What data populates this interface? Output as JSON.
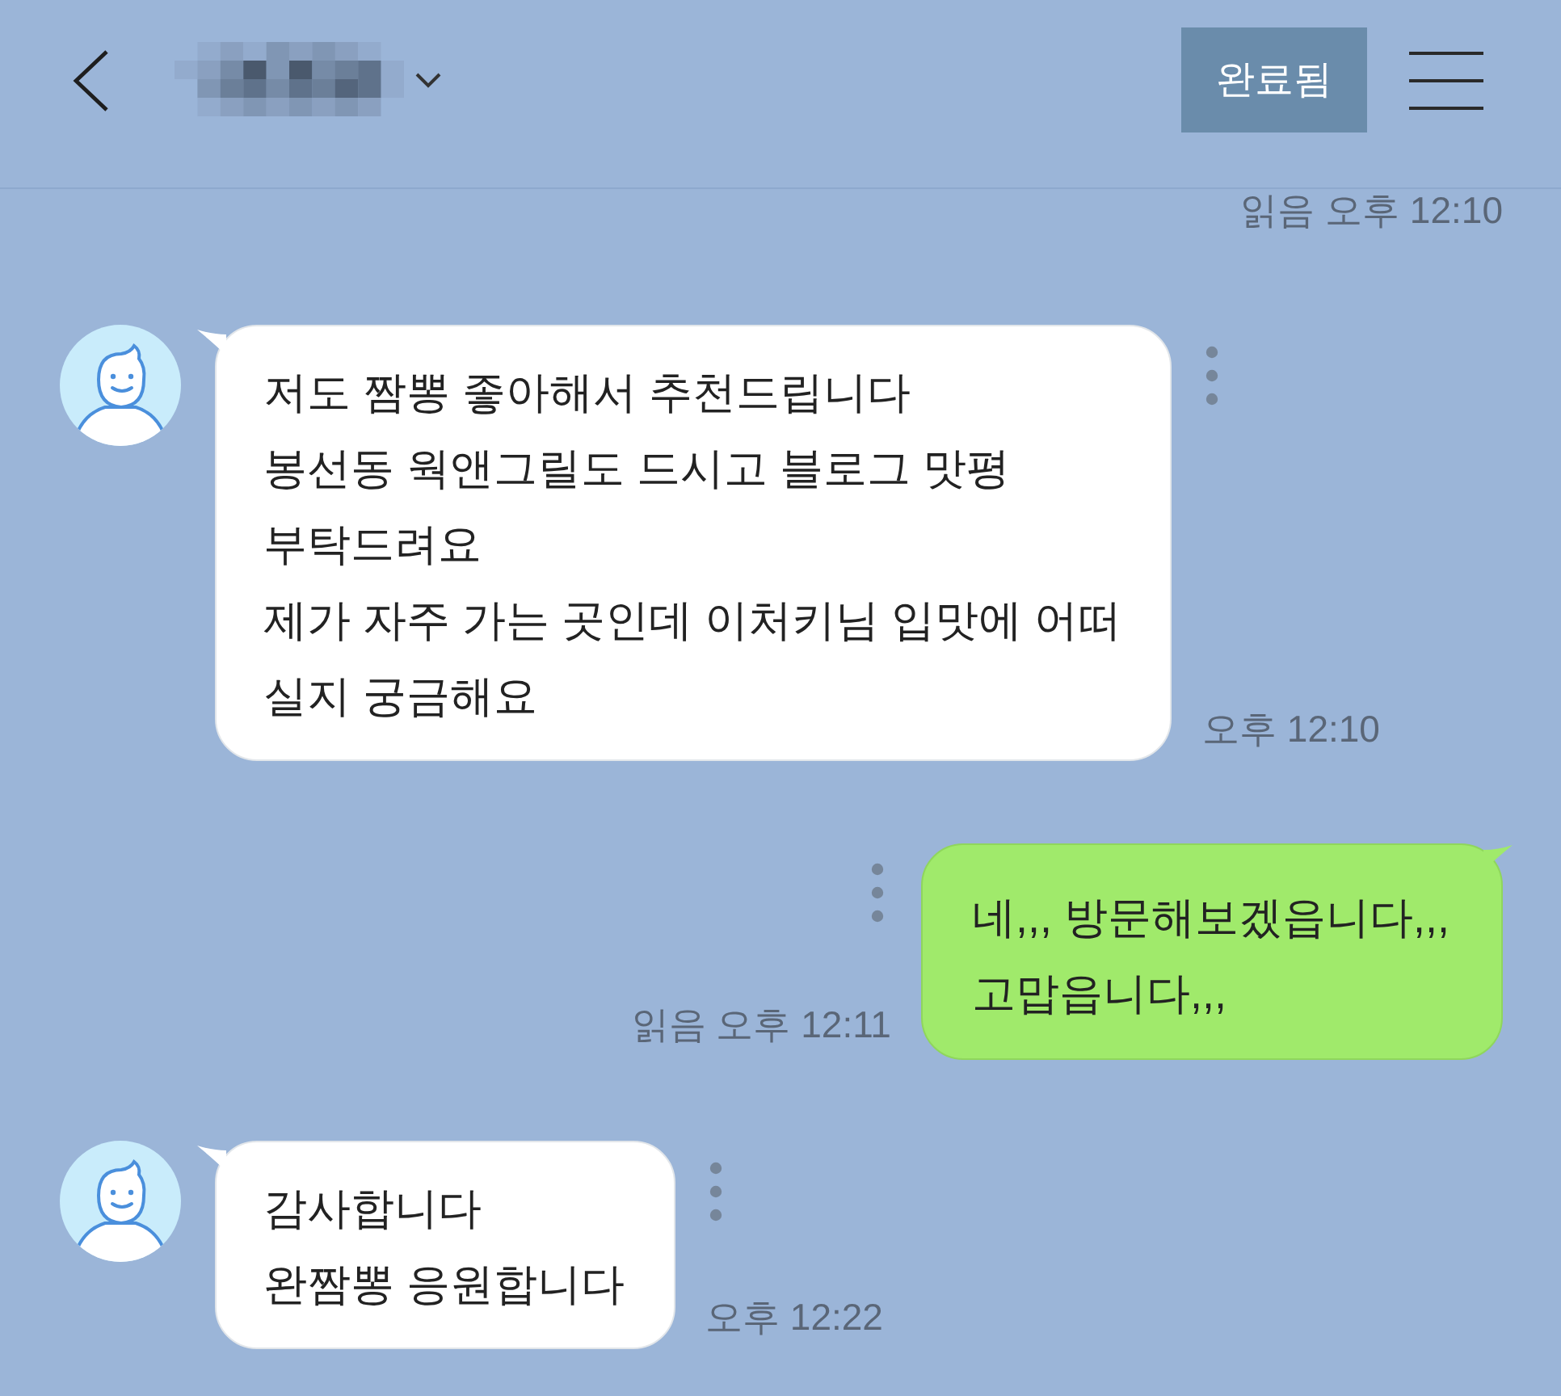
{
  "header": {
    "status_button": "완료됨"
  },
  "top_receipt": "읽음 오후 12:10",
  "messages": [
    {
      "kind": "received",
      "lines": [
        "저도 짬뽕 좋아해서 추천드립니다",
        "봉선동 웍앤그릴도 드시고 블로그 맛평",
        "부탁드려요",
        "제가 자주 가는 곳인데 이처키님 입맛에 어떠",
        "실지 궁금해요"
      ],
      "time": "오후 12:10"
    },
    {
      "kind": "sent",
      "lines": [
        "네,,, 방문해보겠읍니다,,,",
        "고맙읍니다,,,"
      ],
      "time": "읽음 오후 12:11"
    },
    {
      "kind": "received",
      "lines": [
        "감사합니다",
        "완짬뽕 응원합니다"
      ],
      "time": "오후 12:22"
    }
  ]
}
